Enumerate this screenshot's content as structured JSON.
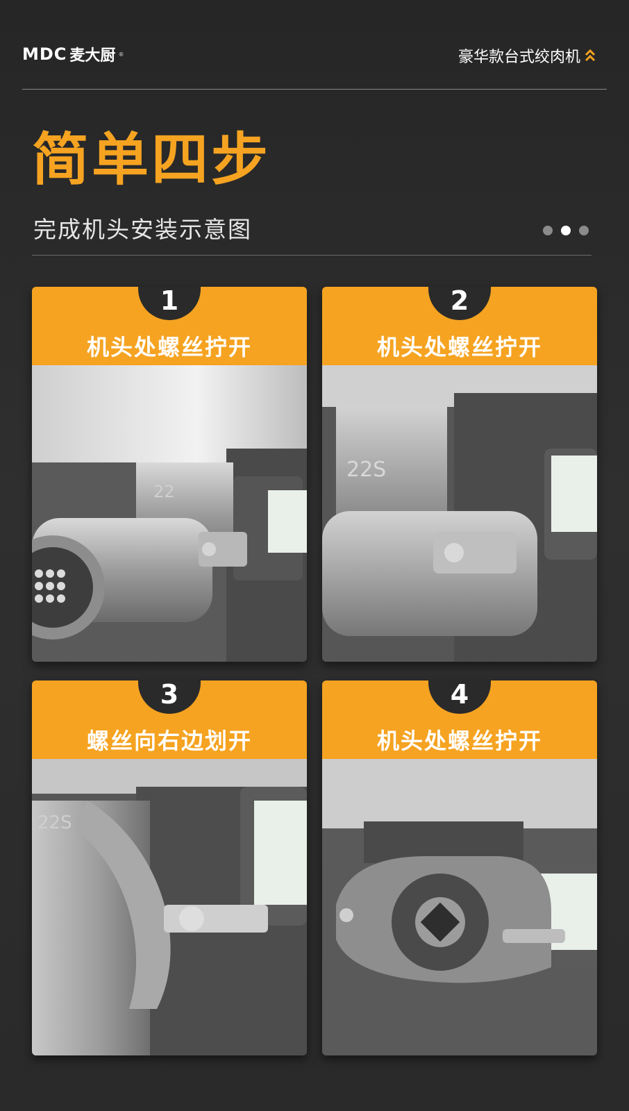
{
  "brand": {
    "latin": "MDC",
    "name": "麦大厨",
    "reg": "®"
  },
  "header": {
    "model": "豪华款台式绞肉机"
  },
  "hero": {
    "title": "简单四步",
    "subtitle": "完成机头安装示意图"
  },
  "pager": {
    "count": 3,
    "active_index": 1
  },
  "steps": [
    {
      "number": "1",
      "label": "机头处螺丝拧开",
      "photo_icon": "grinder-head-closeup",
      "engraving": "22"
    },
    {
      "number": "2",
      "label": "机头处螺丝拧开",
      "photo_icon": "grinder-neck-screw",
      "engraving": "22S"
    },
    {
      "number": "3",
      "label": "螺丝向右边划开",
      "photo_icon": "screw-slide-right",
      "engraving": "22S"
    },
    {
      "number": "4",
      "label": "机头处螺丝拧开",
      "photo_icon": "grinder-head-removed",
      "engraving": ""
    }
  ],
  "colors": {
    "accent": "#f5a321",
    "background": "#2a2a2a",
    "divider": "#8a8a8a"
  }
}
